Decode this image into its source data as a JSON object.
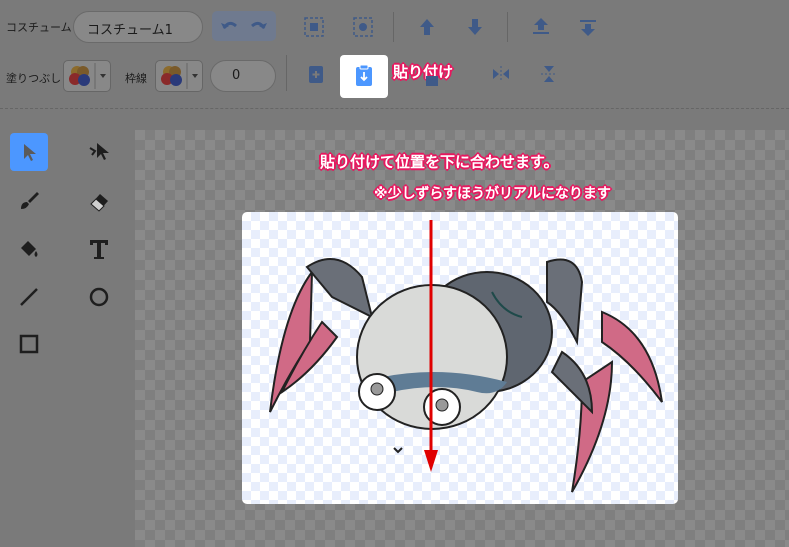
{
  "toolbar": {
    "costume_label": "コスチューム",
    "costume_name": "コスチューム1",
    "fill_label": "塗りつぶし",
    "outline_label": "枠線",
    "outline_width": "0"
  },
  "annotations": {
    "paste_label": "貼り付け",
    "instruction_line1": "貼り付けて位置を下に合わせます。",
    "instruction_line2": "※少しずらすほうがリアルになります"
  },
  "colors": {
    "accent": "#855cd6",
    "highlight_tool": "#4c97ff",
    "annotation_pink": "#e6195f",
    "arrow_red": "#e00000"
  },
  "icons": {
    "select": "arrow-pointer-icon",
    "reshape": "reshape-icon",
    "brush": "brush-icon",
    "eraser": "eraser-icon",
    "fill": "bucket-icon",
    "text": "text-icon",
    "line": "line-icon",
    "circle": "circle-icon",
    "rect": "rectangle-icon"
  }
}
